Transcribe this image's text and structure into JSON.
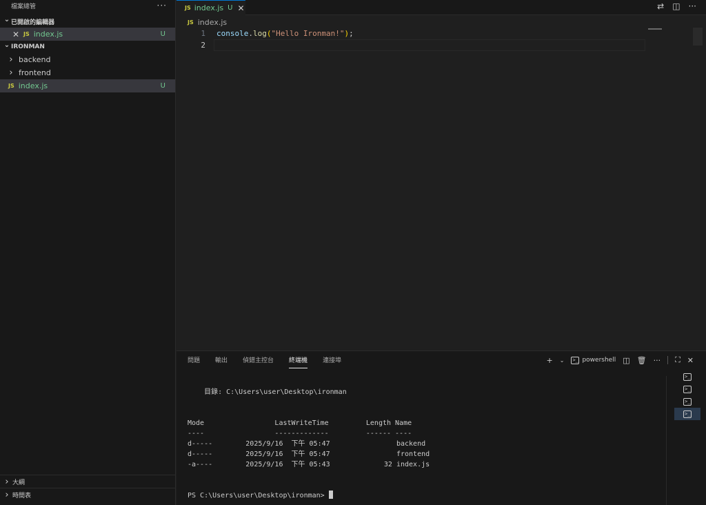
{
  "sidebar": {
    "header": "檔案總管",
    "more": "···",
    "open_editors": {
      "title": "已開啟的編輯器",
      "items": [
        {
          "name": "index.js",
          "icon": "JS",
          "status": "U"
        }
      ]
    },
    "folder": {
      "title": "IRONMAN",
      "items": [
        {
          "name": "backend",
          "type": "folder"
        },
        {
          "name": "frontend",
          "type": "folder"
        },
        {
          "name": "index.js",
          "icon": "JS",
          "status": "U",
          "type": "file"
        }
      ]
    },
    "bottom": [
      {
        "label": "大綱"
      },
      {
        "label": "時間表"
      }
    ]
  },
  "tabs": [
    {
      "label": "index.js",
      "icon": "JS",
      "status": "U"
    }
  ],
  "breadcrumb": {
    "icon": "JS",
    "label": "index.js"
  },
  "editor": {
    "line_numbers": [
      "1",
      "2"
    ],
    "tokens": {
      "obj": "console",
      "dot": ".",
      "fn": "log",
      "open": "(",
      "str": "\"Hello Ironman!\"",
      "close": ")",
      "semi": ";"
    }
  },
  "panel": {
    "tabs": [
      "問題",
      "輸出",
      "偵錯主控台",
      "終端機",
      "連接埠"
    ],
    "active_tab": "終端機",
    "shell_label": "powershell",
    "terminal_lines": [
      "    目錄: C:\\Users\\user\\Desktop\\ironman",
      "",
      "",
      "Mode                 LastWriteTime         Length Name",
      "----                 -------------         ------ ----",
      "d-----        2025/9/16  下午 05:47                backend",
      "d-----        2025/9/16  下午 05:47                frontend",
      "-a----        2025/9/16  下午 05:43             32 index.js",
      "",
      ""
    ],
    "prompt": "PS C:\\Users\\user\\Desktop\\ironman> "
  },
  "colors": {
    "accent": "#0078d4",
    "untracked": "#73c991",
    "js_icon": "#cbcb41"
  }
}
